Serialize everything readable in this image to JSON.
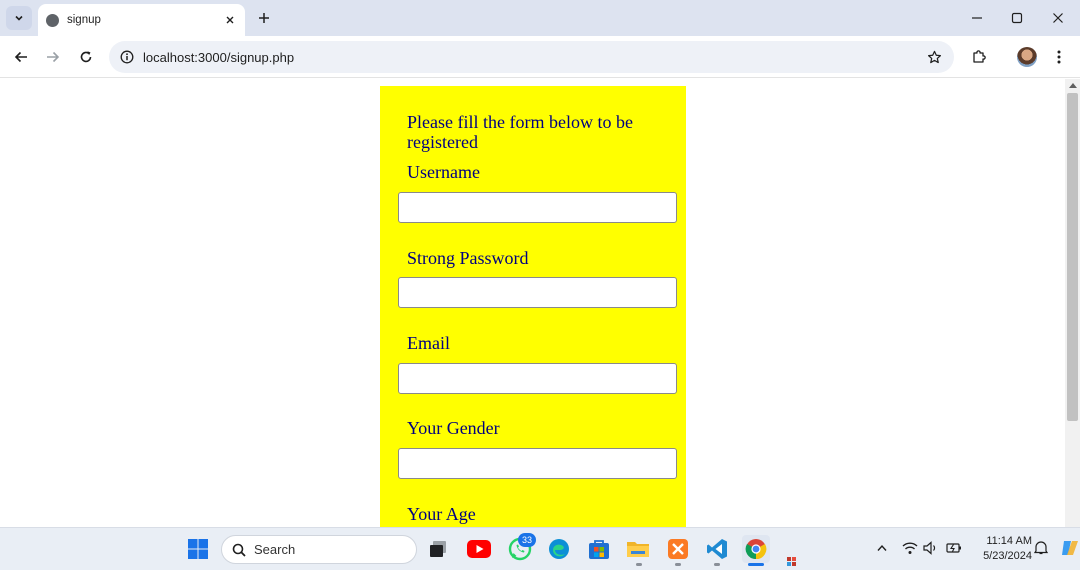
{
  "browser": {
    "tab_title": "signup",
    "url": "localhost:3000/signup.php"
  },
  "form": {
    "intro": "Please fill the form below to be registered",
    "fields": [
      {
        "label": "Username",
        "value": ""
      },
      {
        "label": "Strong Password",
        "value": ""
      },
      {
        "label": "Email",
        "value": ""
      },
      {
        "label": "Your Gender",
        "value": ""
      },
      {
        "label": "Your Age",
        "value": ""
      }
    ],
    "panel_color": "#ffff00",
    "text_color": "#000080"
  },
  "taskbar": {
    "search_label": "Search",
    "whatsapp_badge": "33",
    "time": "11:14 AM",
    "date": "5/23/2024"
  }
}
